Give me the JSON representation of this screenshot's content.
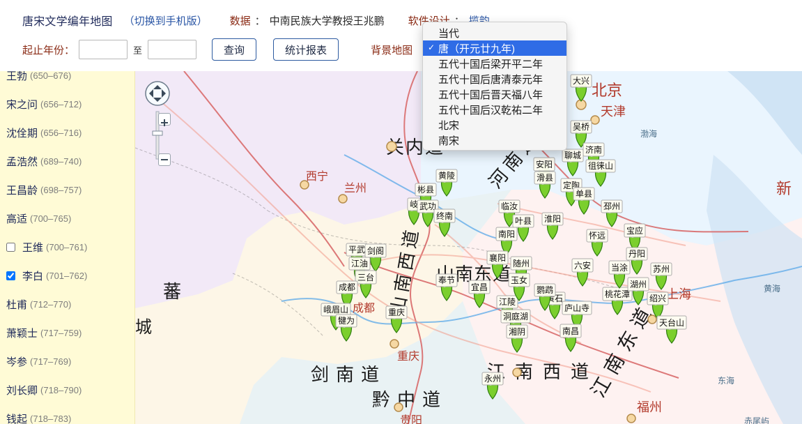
{
  "header": {
    "site_title": "唐宋文学编年地图",
    "switch_mobile": "（切换到手机版）",
    "data_label": "数据",
    "data_sep": "：",
    "data_value": "中南民族大学教授王兆鹏",
    "software_label": "软件设计",
    "software_sep": "：",
    "software_value": "揽韵"
  },
  "filters": {
    "start_label": "起止年份：",
    "to_label": "至",
    "from_value": "",
    "to_value": "",
    "query_button": "查询",
    "stats_button": "统计报表",
    "background_map_label": "背景地图"
  },
  "map_options": {
    "items": [
      {
        "label": "当代",
        "selected": false
      },
      {
        "label": "唐（开元廿九年)",
        "selected": true
      },
      {
        "label": "五代十国后梁开平二年",
        "selected": false
      },
      {
        "label": "五代十国后唐清泰元年",
        "selected": false
      },
      {
        "label": "五代十国后晋天福八年",
        "selected": false
      },
      {
        "label": "五代十国后汉乾祐二年",
        "selected": false
      },
      {
        "label": "北宋",
        "selected": false
      },
      {
        "label": "南宋",
        "selected": false
      }
    ],
    "check_mark": "✓"
  },
  "poets": [
    {
      "name": "王勃",
      "years": "(650–676)",
      "checkbox": null
    },
    {
      "name": "宋之问",
      "years": "(656–712)",
      "checkbox": null
    },
    {
      "name": "沈佺期",
      "years": "(656–716)",
      "checkbox": null
    },
    {
      "name": "孟浩然",
      "years": "(689–740)",
      "checkbox": null
    },
    {
      "name": "王昌龄",
      "years": "(698–757)",
      "checkbox": null
    },
    {
      "name": "高适",
      "years": "(700–765)",
      "checkbox": null
    },
    {
      "name": "王维",
      "years": "(700–761)",
      "checkbox": false
    },
    {
      "name": "李白",
      "years": "(701–762)",
      "checkbox": true
    },
    {
      "name": "杜甫",
      "years": "(712–770)",
      "checkbox": null
    },
    {
      "name": "萧颖士",
      "years": "(717–759)",
      "checkbox": null
    },
    {
      "name": "岑参",
      "years": "(717–769)",
      "checkbox": null
    },
    {
      "name": "刘长卿",
      "years": "(718–790)",
      "checkbox": null
    },
    {
      "name": "钱起",
      "years": "(718–783)",
      "checkbox": null
    }
  ],
  "map": {
    "region_labels": [
      "关内道",
      "山南东道",
      "剑南道",
      "江南西道",
      "黔中道",
      "江南东道",
      "河南道",
      "山南西道",
      "蕃",
      "城"
    ],
    "city_labels_red": [
      "西宁",
      "兰州",
      "成都",
      "重庆",
      "贵阳",
      "北京",
      "天津",
      "福州",
      "上海",
      "新"
    ],
    "water_labels": [
      "渤海",
      "东海",
      "黄海",
      "赤尾屿"
    ],
    "markers": [
      {
        "label": "大兴"
      },
      {
        "label": "吴桥"
      },
      {
        "label": "济南"
      },
      {
        "label": "聊城"
      },
      {
        "label": "徂徕山"
      },
      {
        "label": "安阳"
      },
      {
        "label": "滑县"
      },
      {
        "label": "定陶"
      },
      {
        "label": "单县"
      },
      {
        "label": "邳州"
      },
      {
        "label": "彬县"
      },
      {
        "label": "黄陵"
      },
      {
        "label": "岐"
      },
      {
        "label": "武功"
      },
      {
        "label": "终南"
      },
      {
        "label": "临汝"
      },
      {
        "label": "淮阳"
      },
      {
        "label": "叶县"
      },
      {
        "label": "南阳"
      },
      {
        "label": "怀远"
      },
      {
        "label": "平武"
      },
      {
        "label": "剑阁"
      },
      {
        "label": "江油"
      },
      {
        "label": "三台"
      },
      {
        "label": "成都"
      },
      {
        "label": "峨眉山"
      },
      {
        "label": "犍为"
      },
      {
        "label": "重庆"
      },
      {
        "label": "奉节"
      },
      {
        "label": "宜昌"
      },
      {
        "label": "江陵"
      },
      {
        "label": "洞庭湖"
      },
      {
        "label": "湘阴"
      },
      {
        "label": "黄石"
      },
      {
        "label": "庐山寺"
      },
      {
        "label": "南昌"
      },
      {
        "label": "永州"
      },
      {
        "label": "桃花潭"
      },
      {
        "label": "绍兴"
      },
      {
        "label": "天台山"
      },
      {
        "label": "湖州"
      },
      {
        "label": "苏州"
      },
      {
        "label": "宝应"
      },
      {
        "label": "当涂"
      },
      {
        "label": "丹阳"
      },
      {
        "label": "襄阳"
      },
      {
        "label": "随州"
      },
      {
        "label": "玉女"
      },
      {
        "label": "鹦鹉"
      },
      {
        "label": "六安"
      }
    ]
  },
  "colors": {
    "panel_bg": "#fffbd6",
    "map_boundary_red": "#d96b6b",
    "dropdown_selected": "#2f6ce6",
    "marker_green": "#6dbb2d"
  }
}
